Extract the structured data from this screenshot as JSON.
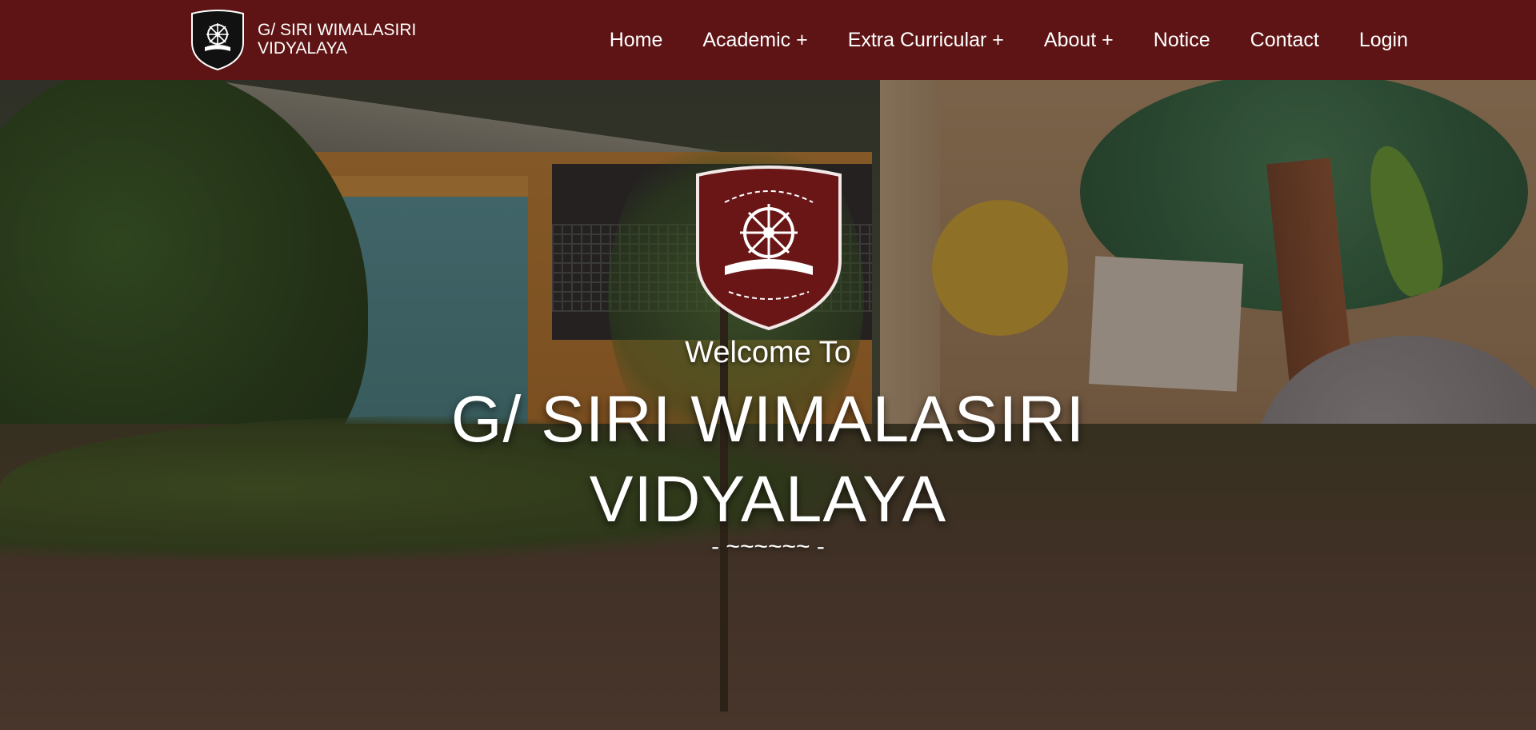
{
  "navbar": {
    "brand_name": "G/ SIRI WIMALASIRI VIDYALAYA",
    "logo_icon": "school-crest-icon",
    "background_color": "#5e1414",
    "items": [
      {
        "label": "Home"
      },
      {
        "label": "Academic +"
      },
      {
        "label": "Extra Curricular +"
      },
      {
        "label": "About +"
      },
      {
        "label": "Notice"
      },
      {
        "label": "Contact"
      },
      {
        "label": "Login"
      }
    ]
  },
  "hero": {
    "crest_icon": "school-crest-icon",
    "welcome": "Welcome To",
    "title": "G/ SIRI WIMALASIRI VIDYALAYA",
    "divider": "- ~~~~~~ -",
    "crest_color": "#6a1616"
  }
}
